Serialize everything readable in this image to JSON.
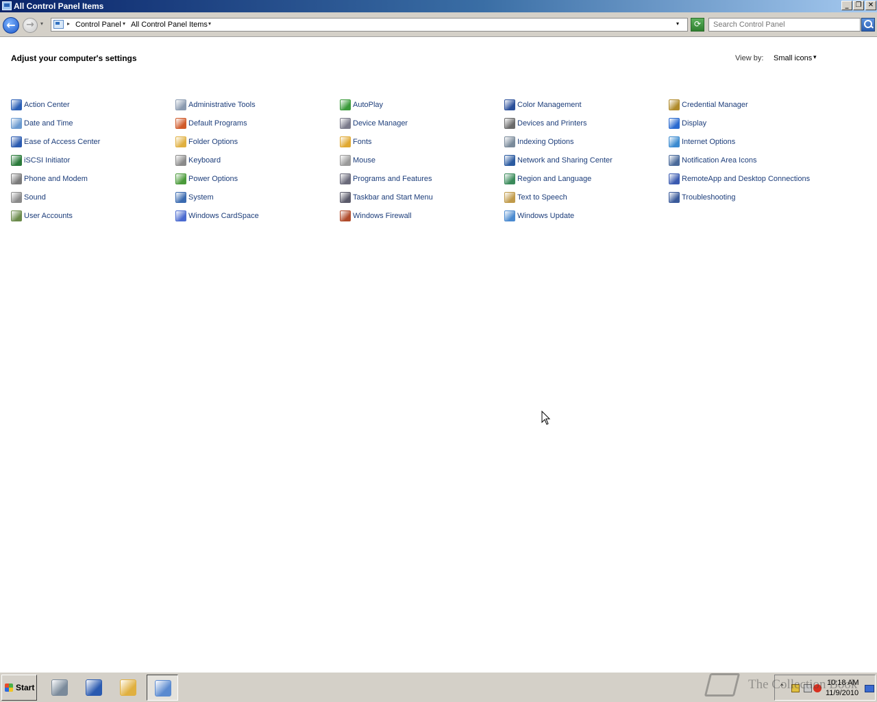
{
  "window": {
    "title": "All Control Panel Items",
    "buttons": {
      "minimize": "_",
      "restore": "❐",
      "close": "✕"
    }
  },
  "address_bar": {
    "back_glyph": "←",
    "forward_glyph": "→",
    "history_glyph": "▾",
    "crumb_sep": "▸",
    "crumbs": [
      "Control Panel",
      "All Control Panel Items"
    ],
    "crumb_arrow": "▾",
    "dropdown_glyph": "▾",
    "refresh_glyph": "⟳",
    "search_placeholder": "Search Control Panel"
  },
  "content": {
    "heading": "Adjust your computer's settings",
    "view_by_label": "View by:",
    "view_by_value": "Small icons",
    "view_by_arrow": "▾",
    "items": [
      {
        "label": "Action Center",
        "icon": "action-center-icon",
        "color": "#2a5fb6"
      },
      {
        "label": "Administrative Tools",
        "icon": "administrative-tools-icon",
        "color": "#8a9ab0"
      },
      {
        "label": "AutoPlay",
        "icon": "autoplay-icon",
        "color": "#3a9a3a"
      },
      {
        "label": "Color Management",
        "icon": "color-management-icon",
        "color": "#2a4f9a"
      },
      {
        "label": "Credential Manager",
        "icon": "credential-manager-icon",
        "color": "#b08a2a"
      },
      {
        "label": "Date and Time",
        "icon": "date-and-time-icon",
        "color": "#6a9ad0"
      },
      {
        "label": "Default Programs",
        "icon": "default-programs-icon",
        "color": "#d05a2a"
      },
      {
        "label": "Device Manager",
        "icon": "device-manager-icon",
        "color": "#7a7a8a"
      },
      {
        "label": "Devices and Printers",
        "icon": "devices-and-printers-icon",
        "color": "#6a6a6a"
      },
      {
        "label": "Display",
        "icon": "display-icon",
        "color": "#2a6ad0"
      },
      {
        "label": "Ease of Access Center",
        "icon": "ease-of-access-icon",
        "color": "#2a5ab0"
      },
      {
        "label": "Folder Options",
        "icon": "folder-options-icon",
        "color": "#e0b040"
      },
      {
        "label": "Fonts",
        "icon": "fonts-icon",
        "color": "#e0a830"
      },
      {
        "label": "Indexing Options",
        "icon": "indexing-options-icon",
        "color": "#7a8a9a"
      },
      {
        "label": "Internet Options",
        "icon": "internet-options-icon",
        "color": "#3a8ad0"
      },
      {
        "label": "iSCSI Initiator",
        "icon": "iscsi-initiator-icon",
        "color": "#2a7a3a"
      },
      {
        "label": "Keyboard",
        "icon": "keyboard-icon",
        "color": "#8a8a8a"
      },
      {
        "label": "Mouse",
        "icon": "mouse-icon",
        "color": "#9a9a9a"
      },
      {
        "label": "Network and Sharing Center",
        "icon": "network-sharing-icon",
        "color": "#2a5aa0"
      },
      {
        "label": "Notification Area Icons",
        "icon": "notification-area-icon",
        "color": "#4a6a9a"
      },
      {
        "label": "Phone and Modem",
        "icon": "phone-modem-icon",
        "color": "#7a7a7a"
      },
      {
        "label": "Power Options",
        "icon": "power-options-icon",
        "color": "#4a9a3a"
      },
      {
        "label": "Programs and Features",
        "icon": "programs-features-icon",
        "color": "#6a6a7a"
      },
      {
        "label": "Region and Language",
        "icon": "region-language-icon",
        "color": "#3a8a5a"
      },
      {
        "label": "RemoteApp and Desktop Connections",
        "icon": "remoteapp-icon",
        "color": "#3a5ab0"
      },
      {
        "label": "Sound",
        "icon": "sound-icon",
        "color": "#8a8a8a"
      },
      {
        "label": "System",
        "icon": "system-icon",
        "color": "#3a6ab0"
      },
      {
        "label": "Taskbar and Start Menu",
        "icon": "taskbar-start-menu-icon",
        "color": "#5a5a6a"
      },
      {
        "label": "Text to Speech",
        "icon": "text-to-speech-icon",
        "color": "#c09a4a"
      },
      {
        "label": "Troubleshooting",
        "icon": "troubleshooting-icon",
        "color": "#3a5a9a"
      },
      {
        "label": "User Accounts",
        "icon": "user-accounts-icon",
        "color": "#6a8a4a"
      },
      {
        "label": "Windows CardSpace",
        "icon": "windows-cardspace-icon",
        "color": "#4a6ad0"
      },
      {
        "label": "Windows Firewall",
        "icon": "windows-firewall-icon",
        "color": "#b04a2a"
      },
      {
        "label": "Windows Update",
        "icon": "windows-update-icon",
        "color": "#4a8ad0"
      }
    ]
  },
  "taskbar": {
    "start_label": "Start",
    "buttons": [
      {
        "icon": "server-manager-icon",
        "color": "#7a8a9a"
      },
      {
        "icon": "powershell-icon",
        "color": "#2a5ab0"
      },
      {
        "icon": "windows-explorer-icon",
        "color": "#e0b040"
      },
      {
        "icon": "control-panel-icon",
        "color": "#5a8ad0"
      }
    ],
    "tray_chevron": "⌃",
    "clock_time": "10:18 AM",
    "clock_date": "11/9/2010"
  },
  "watermark": "The Collection Book"
}
